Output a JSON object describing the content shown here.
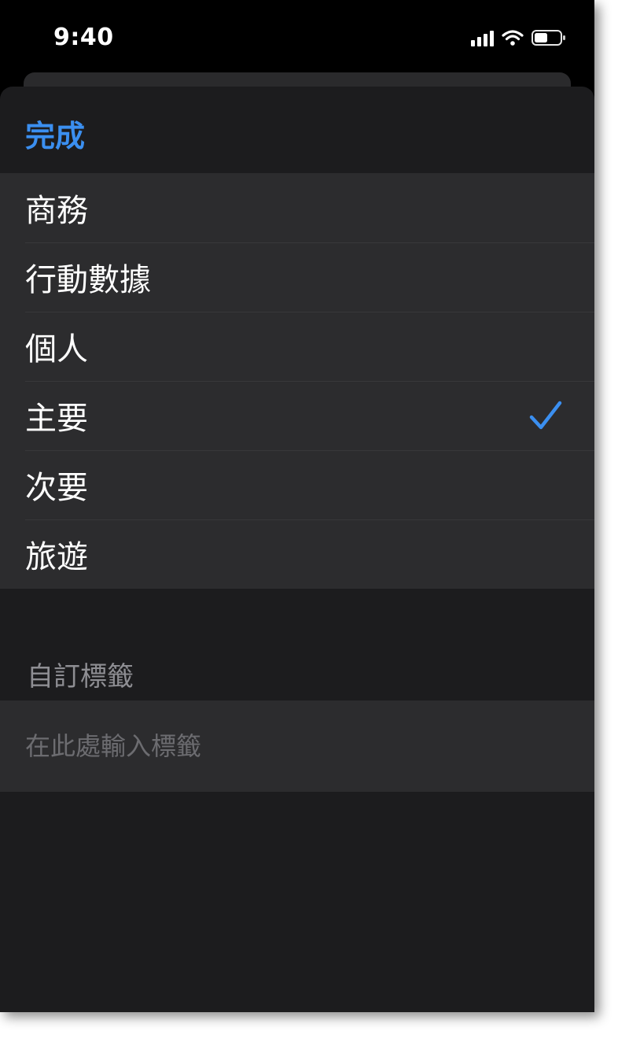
{
  "status_bar": {
    "time": "9:40"
  },
  "header": {
    "done_label": "完成"
  },
  "labels": {
    "items": [
      {
        "label": "商務",
        "selected": false
      },
      {
        "label": "行動數據",
        "selected": false
      },
      {
        "label": "個人",
        "selected": false
      },
      {
        "label": "主要",
        "selected": true
      },
      {
        "label": "次要",
        "selected": false
      },
      {
        "label": "旅遊",
        "selected": false
      }
    ]
  },
  "custom_label": {
    "section_title": "自訂標籤",
    "placeholder": "在此處輸入標籤",
    "value": ""
  },
  "colors": {
    "accent": "#3b8ff0",
    "sheet_background": "#1c1c1e",
    "row_background": "#2c2c2e",
    "secondary_text": "#8e8e93"
  },
  "icons": {
    "selected_marker": "checkmark-icon",
    "status": [
      "signal-icon",
      "wifi-icon",
      "battery-icon"
    ]
  }
}
